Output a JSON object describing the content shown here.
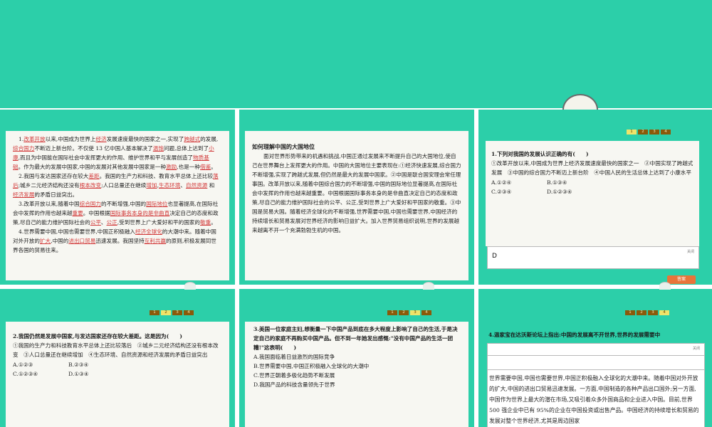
{
  "colors": {
    "teal": "#2ccfa9",
    "paper": "#f7f7f2",
    "red": "#d23a3a",
    "step": "#8a5a0a",
    "step_active": "#f0e46a",
    "answer_button": "#e8743a"
  },
  "step_labels": [
    "1",
    "2",
    "3",
    "4"
  ],
  "close_label": "关闭",
  "answer_button": "答案",
  "s1": {
    "p1": {
      "a": "1.",
      "b1": "改革开放",
      "c": "以来,中国成为世界上",
      "b2": "经济",
      "d": "发展速度最快的国家之一,实现了",
      "b3": "跨越式",
      "e": "的发展,",
      "b4": "综合国力",
      "f": "不断迈上新台阶。不仅使 13 亿中国人基本解决了",
      "b5": "温饱",
      "g": "问题,总体上达到了",
      "b6": "小康",
      "h": ",而且为中国能在国际社会中发挥更大的作用、维护世界和平与发展创造了",
      "b7": "物质基础",
      "i": "。作为最大的发展中国家,中国的发展对其他发展中国家是一种",
      "b8": "激励",
      "j": ",也是一种",
      "b9": "借鉴",
      "k": "。"
    },
    "p2": {
      "a": "2.我国与发达国家还存在较大",
      "b1": "差距",
      "c": "。我国的生产力和科技、教育水平总体上还比较",
      "b2": "落后",
      "d": ";城乡二元经济结构还没有",
      "b3": "根本改变",
      "e": ";人口总量还在继续",
      "b4": "增加",
      "f": ",",
      "b5": "生态环境",
      "g": "、",
      "b6": "自然资源",
      "h": " 和",
      "b7": "经济发展",
      "i": "的矛盾日益突出。"
    },
    "p3": {
      "a": "3.改革开放以来,随着中国",
      "b1": "综合国力",
      "c": "的不断增强,中国的",
      "b2": "国际地位",
      "d": "也显著提高,在国际社会中发挥的作用也越来越",
      "b3": "重要",
      "e": "。中国根据",
      "b4": "国际事务本身的是非曲直",
      "f": "决定自己的态度和政策,尽自己的能力维护国际社会的",
      "b5": "公平",
      "g": "、",
      "b6": "公正",
      "h": ",受到世界上广大爱好和平的国家的",
      "b7": "敬重",
      "i": "。"
    },
    "p4": {
      "a": "4.世界需要中国,中国也需要世界,中国正积极融入",
      "b1": "经济全球化",
      "c": "的大潮中来。随着中国对外开放的",
      "b2": "扩大",
      "d": ",中国的",
      "b3": "进出口贸易",
      "e": "迅速发展。我国坚持",
      "b4": "互利共赢",
      "f": "的原则,积极发展同世界各国的贸易往来。"
    }
  },
  "s2": {
    "heading": "如何理解中国的大国地位",
    "body": "面对世界形势带来的机遇和挑战,中国正通过发展来不断提升自己的大国地位,使自己在世界舞台上发挥更大的作用。中国的大国地位主要表现在:①经济快速发展,综合国力不断增强,实现了跨越式发展,但仍然是最大的发展中国家。②中国是联合国安理会常任理事国。改革开放以来,随着中国综合国力的不断增强,中国的国际地位显著提高,在国际社会中发挥的作用也越来越重要。中国根据国际事务本身的是非曲直决定自己的态度和政策,尽自己的能力维护国际社会的公平、公正,受到世界上广大爱好和平国家的敬重。③中国是贸易大国。随着经济全球化的不断增强,世界需要中国,中国也需要世界,中国经济的持续增长和贸易发展对世界经济的影响日益扩大。加入世界贸易组织说明,世界的发展越来越离不开一个充满勃勃生机的中国。"
  },
  "s3": {
    "question": "1.下列对我国的发展认识正确的有(　　)",
    "stmt": "①改革开放以来,中国成为世界上经济发展速度最快的国家之一　②中国实现了跨越式发展　③中国的综合国力不断迈上新台阶　④中国人民的生活总体上达到了小康水平",
    "options": [
      "A.①②④",
      "B.①③④",
      "C.②③④",
      "D.①②③④"
    ],
    "answer": "D"
  },
  "s4": {
    "question": "2.我国仍然是发展中国家,与发达国家还存在较大差距。这是因为(　　)",
    "stmt": "①我国的生产力和科技教育水平总体上还比较落后　②城乡二元经济结构还没有根本改变　③人口总量还在继续增加　④生态环境、自然资源和经济发展的矛盾日益突出",
    "options": [
      "A.①②③",
      "B.②③④",
      "C.①②③④",
      "D.①③④"
    ]
  },
  "s5": {
    "question": "3.美国一位家庭主妇,想衡量一下中国产品到底在多大程度上影响了自己的生活,于是决定自己的家庭不再购买中国产品。但不到一年她发出感慨:\"没有中国产品的生活一团糟!\"这表明(　　)",
    "options": [
      "A.我国面临着日益激烈的国际竞争",
      "B.世界需要中国,中国正积极融入全球化的大潮中",
      "C.世界正朝着多极化趋势不断发展",
      "D.我国产品的科技含量领先于世界"
    ]
  },
  "s6": {
    "question": "4.温家宝在达沃斯论坛上指出:中国的发展离不开世界,世界的发展需要中",
    "body": "世界需要中国,中国也需要世界,中国正积极融入全球化的大潮中来。随着中国对外开放的扩大,中国的进出口贸易迅速发展。一方面,中国制造的各种产品出口国外;另一方面,中国作为世界上最大的潜在市场,又吸引着众多外国商品和企业进入中国。目前,世界 500 强企业中已有 95%的企业在中国投资或出售产品。中国经济的持续增长和贸易的发展对整个世界经济,尤其是周边国家"
  }
}
